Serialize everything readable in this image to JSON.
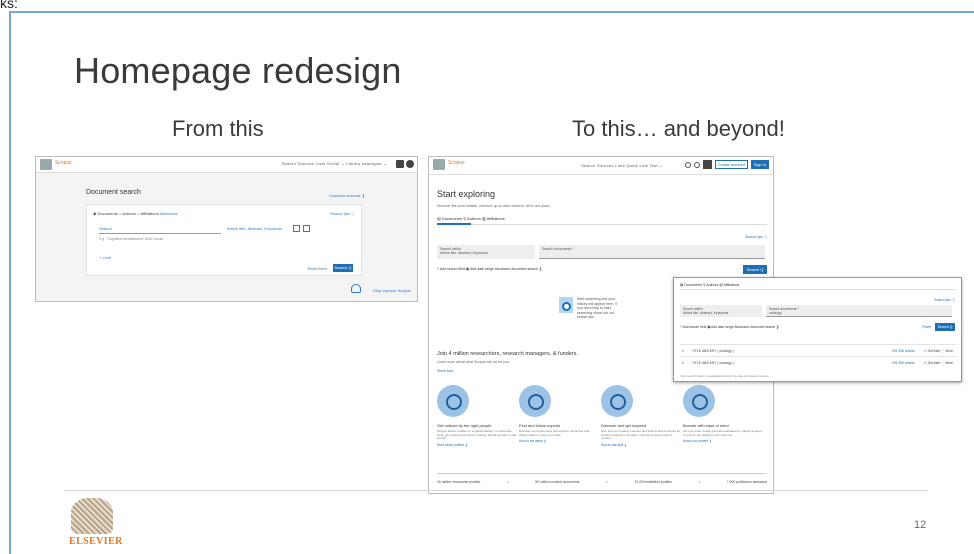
{
  "top_strip_text": "ks:",
  "slide": {
    "title": "Homepage redesign",
    "from_label": "From this",
    "to_label": "To this… and beyond!",
    "page_number": "12",
    "logo_text": "ELSEVIER"
  },
  "from_shot": {
    "brand": "Scopus",
    "nav": "Search   Sources   Lists   SciVal ⌄   Library catalogue ⌄",
    "heading": "Document search",
    "compare": "Compare sources ❯",
    "tabs": "◉ Documents   ○ Authors   ○ Affiliations",
    "tabs_extra": "Advanced",
    "tips": "Search tips ⓘ",
    "search_label": "Search",
    "hint": "E.g. \"Cognitive architectures\" AND robots",
    "field": "Article title, Abstract, Keywords",
    "limits": "+ Limit",
    "reset": "Reset form",
    "search_button": "Search Q",
    "help": "Help improve Scopus"
  },
  "to_shot": {
    "brand": "Scopus",
    "nav": "Search   Sources   Lists   Quick Link Test ⌄",
    "create_account": "Create account",
    "sign_in": "Sign in",
    "heading": "Start exploring",
    "desc": "Discover the most reliable, relevant, up-to-date research. All in one place.",
    "tabs": "▤ Documents    ⚲ Authors    ▥ Affiliations",
    "tips": "Search tips ⓘ",
    "select_label": "Search within",
    "select_value": "Article title, Abstract, Keywords",
    "input_placeholder": "Search documents *",
    "add": "+ Add search field   ▣ Add date range   Advanced document search ❯",
    "search_button": "Search Q",
    "hint_text": "Start searching and your history will appear here. If you need help to start searching check out our search tips.",
    "join_title": "Join 4 million researchers, research managers, & funders.",
    "join_sub": "Learn more about what Scopus can do for you.",
    "show_less": "Show less",
    "features": [
      {
        "title": "Get noticed by the right people",
        "desc": "Scopus author profiles on a global platform to showcase work, get noticed and secure funding. Would you like to add yours?",
        "link": "More about profiles ❯"
      },
      {
        "title": "Find and follow experts",
        "desc": "Discover and track peers and experts, list author and citation alerts to stay up to date.",
        "link": "How to set alerts ❯"
      },
      {
        "title": "Discover and get inspired",
        "desc": "Dive into our curated, relevant and linked content across all subject areas from all years. Use lists to keep track of content.",
        "link": "How to use lists ❯"
      },
      {
        "title": "Browse with ease of mind",
        "desc": "We only index quality journals evaluated by subject experts, to ensure you publish in the right one.",
        "link": "About our content ❯"
      }
    ],
    "stats": [
      "16 million researcher profiles",
      "•",
      "80 million curated documents",
      "•",
      "70,000 institution profiles",
      "•",
      "7,000 publishers assessed"
    ]
  },
  "overlay_shot": {
    "tabs": "▤ Documents    ⚲ Authors    ▥ Affiliations",
    "tips": "Search tips ⓘ",
    "select_label": "Search within",
    "select_value": "Article title, Abstract, Keywords",
    "input_label": "Search documents *",
    "input_value": "ontology",
    "add": "+ Add search field   ▣ Add date range   Advanced document search ❯",
    "reset": "Reset",
    "search_button": "Search Q",
    "rows": [
      {
        "num": "1",
        "query": "TITLE-ABS-KEY ( ontology )",
        "count": "291,396 results",
        "actions": "☐ Set Alert   ⋮ More"
      },
      {
        "num": "2",
        "query": "TITLE-ABS-KEY ( ontology )",
        "count": "291,396 results",
        "actions": "☐ Set Alert   ⋮ More"
      }
    ],
    "footer": "Your search history is available through the use of browser cookies."
  }
}
